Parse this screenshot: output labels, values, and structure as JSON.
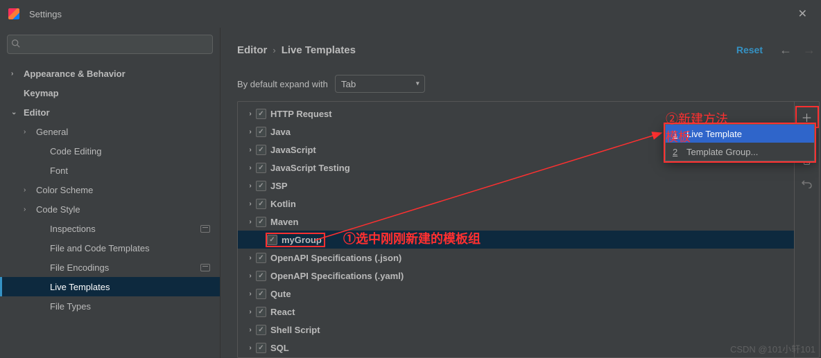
{
  "window": {
    "title": "Settings"
  },
  "sidebar": {
    "search_placeholder": "",
    "items": [
      {
        "label": "Appearance & Behavior",
        "level": 0,
        "chev": "right",
        "bold": true
      },
      {
        "label": "Keymap",
        "level": 0,
        "chev": "",
        "bold": true
      },
      {
        "label": "Editor",
        "level": 0,
        "chev": "down",
        "bold": true
      },
      {
        "label": "General",
        "level": 1,
        "chev": "right"
      },
      {
        "label": "Code Editing",
        "level": 2,
        "chev": ""
      },
      {
        "label": "Font",
        "level": 2,
        "chev": ""
      },
      {
        "label": "Color Scheme",
        "level": 1,
        "chev": "right"
      },
      {
        "label": "Code Style",
        "level": 1,
        "chev": "right"
      },
      {
        "label": "Inspections",
        "level": 2,
        "chev": "",
        "proj": true
      },
      {
        "label": "File and Code Templates",
        "level": 2,
        "chev": ""
      },
      {
        "label": "File Encodings",
        "level": 2,
        "chev": "",
        "proj": true
      },
      {
        "label": "Live Templates",
        "level": 2,
        "chev": "",
        "selected": true
      },
      {
        "label": "File Types",
        "level": 2,
        "chev": ""
      }
    ]
  },
  "breadcrumb": {
    "part1": "Editor",
    "sep": "›",
    "part2": "Live Templates",
    "reset": "Reset"
  },
  "expand": {
    "label": "By default expand with",
    "value": "Tab"
  },
  "templates": [
    {
      "label": "HTTP Request",
      "checked": true
    },
    {
      "label": "Java",
      "checked": true
    },
    {
      "label": "JavaScript",
      "checked": true
    },
    {
      "label": "JavaScript Testing",
      "checked": true
    },
    {
      "label": "JSP",
      "checked": true
    },
    {
      "label": "Kotlin",
      "checked": true
    },
    {
      "label": "Maven",
      "checked": true
    },
    {
      "label": "myGroup",
      "checked": true,
      "selected": true,
      "redbox": true,
      "no_chev": true
    },
    {
      "label": "OpenAPI Specifications (.json)",
      "checked": true
    },
    {
      "label": "OpenAPI Specifications (.yaml)",
      "checked": true
    },
    {
      "label": "Qute",
      "checked": true
    },
    {
      "label": "React",
      "checked": true
    },
    {
      "label": "Shell Script",
      "checked": true
    },
    {
      "label": "SQL",
      "checked": true
    }
  ],
  "popup": {
    "items": [
      {
        "num": "1",
        "label": "Live Template",
        "sel": true
      },
      {
        "num": "2",
        "label": "Template Group...",
        "sel": false
      }
    ]
  },
  "annotations": {
    "a1": "①选中刚刚新建的模板组",
    "a2": "②新建方法模板"
  },
  "watermark": "CSDN @101小轩101"
}
